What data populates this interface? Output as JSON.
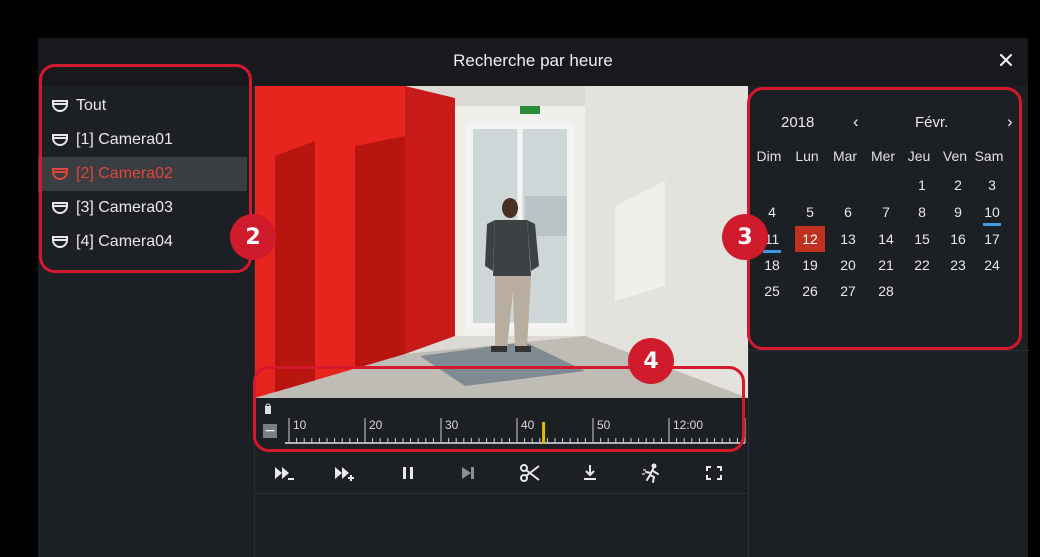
{
  "window": {
    "title": "Recherche par heure",
    "close_icon": "close-icon"
  },
  "cameras": [
    {
      "label": "Tout",
      "active": false
    },
    {
      "label": "[1] Camera01",
      "active": false
    },
    {
      "label": "[2] Camera02",
      "active": true
    },
    {
      "label": "[3] Camera03",
      "active": false
    },
    {
      "label": "[4] Camera04",
      "active": false
    }
  ],
  "timeline": {
    "zoom_out_symbol": "−",
    "labels": [
      "10",
      "20",
      "30",
      "40",
      "50",
      "12:00"
    ],
    "cursor_position_fraction": 0.555
  },
  "controls": [
    {
      "name": "slow-playback-button",
      "icon": "slow-forward-icon"
    },
    {
      "name": "fast-forward-button",
      "icon": "fast-forward-icon"
    },
    {
      "name": "pause-button",
      "icon": "pause-icon"
    },
    {
      "name": "next-frame-button",
      "icon": "next-frame-icon"
    },
    {
      "name": "clip-button",
      "icon": "scissors-icon"
    },
    {
      "name": "download-button",
      "icon": "download-icon"
    },
    {
      "name": "smart-search-button",
      "icon": "motion-person-icon"
    },
    {
      "name": "fullscreen-button",
      "icon": "fullscreen-icon"
    }
  ],
  "calendar": {
    "year": "2018",
    "prev": "‹",
    "month": "Févr.",
    "next": "›",
    "weekdays": [
      "Dim",
      "Lun",
      "Mar",
      "Mer",
      "Jeu",
      "Ven",
      "Sam"
    ],
    "weeks": [
      [
        "",
        "",
        "",
        "",
        "1",
        "2",
        "3"
      ],
      [
        "4",
        "5",
        "6",
        "7",
        "8",
        "9",
        "10"
      ],
      [
        "11",
        "12",
        "13",
        "14",
        "15",
        "16",
        "17"
      ],
      [
        "18",
        "19",
        "20",
        "21",
        "22",
        "23",
        "24"
      ],
      [
        "25",
        "26",
        "27",
        "28",
        "",
        "",
        ""
      ]
    ],
    "selected_day": "12",
    "recorded_days": [
      "10",
      "11"
    ]
  },
  "callouts": [
    "2",
    "3",
    "4"
  ],
  "colors": {
    "accent": "#c0321f",
    "callout": "#d3192b",
    "record_marker": "#3b9be8",
    "active_text": "#e0463a"
  }
}
